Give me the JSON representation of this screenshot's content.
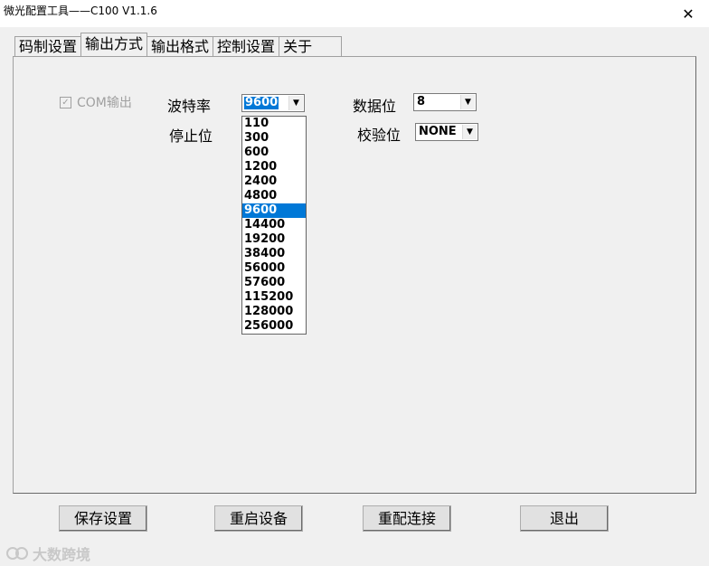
{
  "window": {
    "title": "微光配置工具——C100 V1.1.6",
    "close": "✕"
  },
  "tabs": [
    {
      "label": "码制设置"
    },
    {
      "label": "输出方式"
    },
    {
      "label": "输出格式"
    },
    {
      "label": "控制设置"
    },
    {
      "label": "关于"
    }
  ],
  "active_tab": "输出方式",
  "form": {
    "com_output_label": "COM输出",
    "com_output_checked": true,
    "baud_label": "波特率",
    "baud_value": "9600",
    "stop_label": "停止位",
    "data_bits_label": "数据位",
    "data_bits_value": "8",
    "parity_label": "校验位",
    "parity_value": "NONE"
  },
  "baud_options": [
    "110",
    "300",
    "600",
    "1200",
    "2400",
    "4800",
    "9600",
    "14400",
    "19200",
    "38400",
    "56000",
    "57600",
    "115200",
    "128000",
    "256000"
  ],
  "baud_selected_index": 6,
  "buttons": {
    "save": "保存设置",
    "restart": "重启设备",
    "reconnect": "重配连接",
    "exit": "退出"
  },
  "watermark": "大数跨境",
  "colors": {
    "selection": "#0078d7",
    "disabled_text": "#a0a0a0"
  }
}
